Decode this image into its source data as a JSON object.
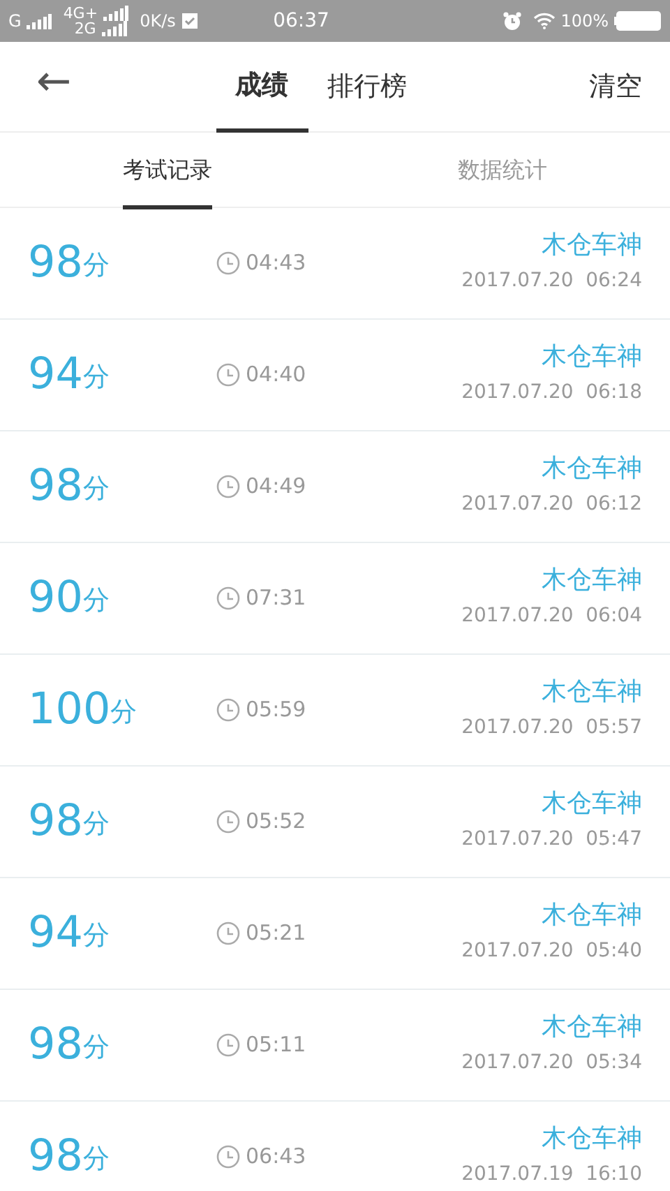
{
  "status_bar": {
    "carrier_1": "G",
    "carrier_2_top": "4G+",
    "carrier_2_bottom": "2G",
    "speed": "0K/s",
    "time": "06:37",
    "battery": "100%"
  },
  "header": {
    "back": "←",
    "tabs": [
      {
        "label": "成绩",
        "selected": true
      },
      {
        "label": "排行榜",
        "selected": false
      }
    ],
    "action": "清空"
  },
  "sub_tabs": [
    {
      "label": "考试记录",
      "selected": true
    },
    {
      "label": "数据统计",
      "selected": false
    }
  ],
  "records": [
    {
      "score": "98",
      "unit": "分",
      "duration": "04:43",
      "user": "木仓车神",
      "date": "2017.07.20  06:24"
    },
    {
      "score": "94",
      "unit": "分",
      "duration": "04:40",
      "user": "木仓车神",
      "date": "2017.07.20  06:18"
    },
    {
      "score": "98",
      "unit": "分",
      "duration": "04:49",
      "user": "木仓车神",
      "date": "2017.07.20  06:12"
    },
    {
      "score": "90",
      "unit": "分",
      "duration": "07:31",
      "user": "木仓车神",
      "date": "2017.07.20  06:04"
    },
    {
      "score": "100",
      "unit": "分",
      "duration": "05:59",
      "user": "木仓车神",
      "date": "2017.07.20  05:57"
    },
    {
      "score": "98",
      "unit": "分",
      "duration": "05:52",
      "user": "木仓车神",
      "date": "2017.07.20  05:47"
    },
    {
      "score": "94",
      "unit": "分",
      "duration": "05:21",
      "user": "木仓车神",
      "date": "2017.07.20  05:40"
    },
    {
      "score": "98",
      "unit": "分",
      "duration": "05:11",
      "user": "木仓车神",
      "date": "2017.07.20  05:34"
    },
    {
      "score": "98",
      "unit": "分",
      "duration": "06:43",
      "user": "木仓车神",
      "date": "2017.07.19  16:10"
    }
  ]
}
